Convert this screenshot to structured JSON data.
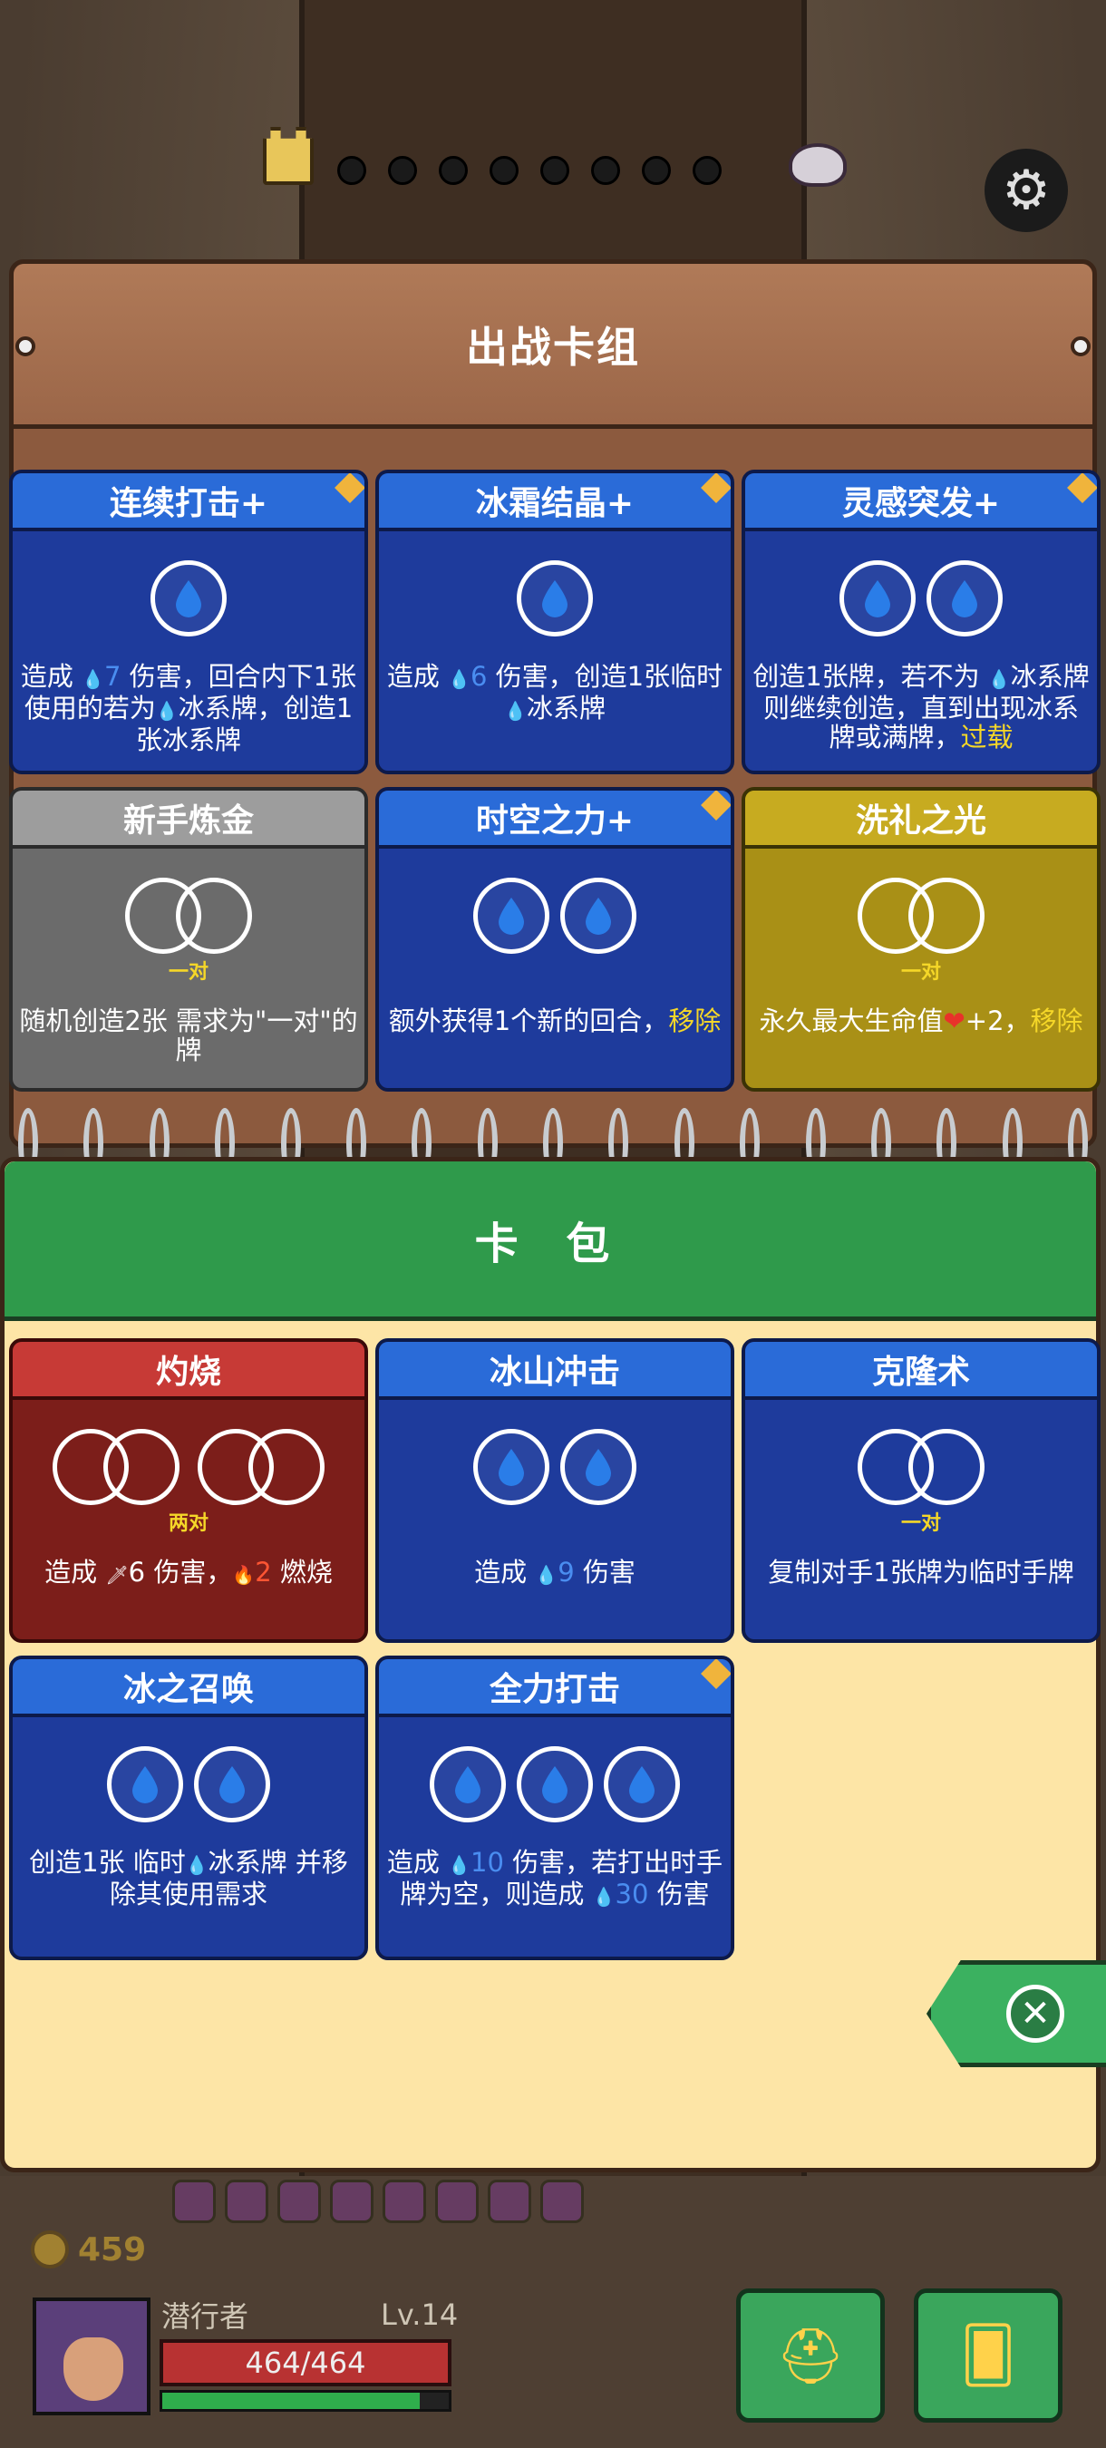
{
  "deck": {
    "title": "出战卡组",
    "cards": [
      {
        "name": "连续打击+",
        "style": "blue",
        "plus": true,
        "slots": 1,
        "desc_parts": [
          {
            "t": "造成 "
          },
          {
            "t": "💧",
            "c": "icon"
          },
          {
            "t": "7",
            "c": "num"
          },
          {
            "t": " 伤害，回合内下1张使用的若为"
          },
          {
            "t": "💧",
            "c": "icon"
          },
          {
            "t": "冰系牌，创造1张冰系牌"
          }
        ]
      },
      {
        "name": "冰霜结晶+",
        "style": "blue",
        "plus": true,
        "slots": 1,
        "desc_parts": [
          {
            "t": "造成 "
          },
          {
            "t": "💧",
            "c": "icon"
          },
          {
            "t": "6",
            "c": "num"
          },
          {
            "t": " 伤害，创造1张临时"
          },
          {
            "t": "💧",
            "c": "icon"
          },
          {
            "t": "冰系牌"
          }
        ]
      },
      {
        "name": "灵感突发+",
        "style": "blue",
        "plus": true,
        "slots": 2,
        "desc_parts": [
          {
            "t": "创造1张牌，若不为 "
          },
          {
            "t": "💧",
            "c": "icon"
          },
          {
            "t": "冰系牌则继续创造，直到出现冰系牌或满牌，"
          },
          {
            "t": "过载",
            "c": "hl"
          }
        ]
      },
      {
        "name": "新手炼金",
        "style": "gray",
        "plus": false,
        "pair": 1,
        "need": "一对",
        "desc_parts": [
          {
            "t": "随机创造2张 需求为\"一对\"的牌"
          }
        ]
      },
      {
        "name": "时空之力+",
        "style": "blue",
        "plus": true,
        "slots": 2,
        "desc_parts": [
          {
            "t": "额外获得1个新的回合，"
          },
          {
            "t": "移除",
            "c": "hl"
          }
        ]
      },
      {
        "name": "洗礼之光",
        "style": "gold",
        "plus": false,
        "pair": 1,
        "need": "一对",
        "desc_parts": [
          {
            "t": "永久最大生命值"
          },
          {
            "t": "❤",
            "c": "heart"
          },
          {
            "t": "+2，"
          },
          {
            "t": "移除",
            "c": "hl"
          }
        ]
      }
    ]
  },
  "pack": {
    "title": "卡 包",
    "cards": [
      {
        "name": "灼烧",
        "style": "red",
        "plus": false,
        "pair": 2,
        "need": "两对",
        "desc_parts": [
          {
            "t": "造成 "
          },
          {
            "t": "🗡",
            "c": "icon"
          },
          {
            "t": "6 伤害，"
          },
          {
            "t": "🔥",
            "c": "icon"
          },
          {
            "t": "2",
            "c": "fire"
          },
          {
            "t": " 燃烧"
          }
        ]
      },
      {
        "name": "冰山冲击",
        "style": "blue",
        "plus": false,
        "slots": 2,
        "desc_parts": [
          {
            "t": "造成 "
          },
          {
            "t": "💧",
            "c": "icon"
          },
          {
            "t": "9",
            "c": "num"
          },
          {
            "t": " 伤害"
          }
        ]
      },
      {
        "name": "克隆术",
        "style": "blue",
        "plus": false,
        "pair": 1,
        "need": "一对",
        "desc_parts": [
          {
            "t": "复制对手1张牌为临时手牌"
          }
        ]
      },
      {
        "name": "冰之召唤",
        "style": "blue",
        "plus": false,
        "slots": 2,
        "desc_parts": [
          {
            "t": "创造1张 临时"
          },
          {
            "t": "💧",
            "c": "icon"
          },
          {
            "t": "冰系牌 并移除其使用需求"
          }
        ]
      },
      {
        "name": "全力打击",
        "style": "blue",
        "plus": true,
        "slots": 3,
        "desc_parts": [
          {
            "t": "造成 "
          },
          {
            "t": "💧",
            "c": "icon"
          },
          {
            "t": "10",
            "c": "num"
          },
          {
            "t": " 伤害，若打出时手牌为空，则造成 "
          },
          {
            "t": "💧",
            "c": "icon"
          },
          {
            "t": "30",
            "c": "num"
          },
          {
            "t": " 伤害"
          }
        ]
      }
    ]
  },
  "player": {
    "name": "潜行者",
    "level": "Lv.14",
    "hp": "464/464",
    "gold": "459",
    "xp_fraction": 0.9
  },
  "colors": {
    "ice_drop": "#2a7de8",
    "highlight": "#f5d728",
    "heart": "#e8322a",
    "fire": "#ff5533"
  },
  "icons": {
    "settings": "gear-icon",
    "close": "close-icon",
    "helmet": "helmet-icon",
    "cards": "cards-icon"
  }
}
